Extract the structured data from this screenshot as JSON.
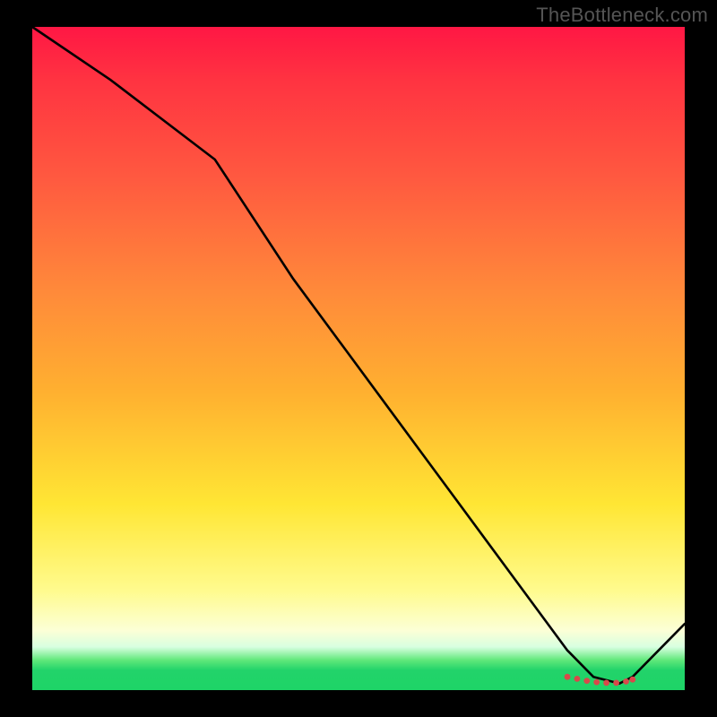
{
  "watermark": "TheBottleneck.com",
  "chart_data": {
    "type": "line",
    "title": "",
    "xlabel": "",
    "ylabel": "",
    "xlim": [
      0,
      100
    ],
    "ylim": [
      0,
      100
    ],
    "series": [
      {
        "name": "curve",
        "x": [
          0,
          12,
          28,
          40,
          55,
          70,
          82,
          86,
          90,
          92,
          100
        ],
        "y": [
          100,
          92,
          80,
          62,
          42,
          22,
          6,
          2,
          1,
          2,
          10
        ]
      }
    ],
    "markers": {
      "name": "dots",
      "color": "#d8494a",
      "x": [
        82,
        83.5,
        85,
        86.5,
        88,
        89.5,
        91,
        92
      ],
      "y": [
        2.0,
        1.7,
        1.4,
        1.2,
        1.1,
        1.1,
        1.3,
        1.6
      ]
    },
    "gradient_stops": [
      {
        "pos": 0,
        "color": "#ff1744"
      },
      {
        "pos": 0.4,
        "color": "#ff8a3a"
      },
      {
        "pos": 0.72,
        "color": "#ffe634"
      },
      {
        "pos": 0.91,
        "color": "#fcffd6"
      },
      {
        "pos": 0.97,
        "color": "#22d36a"
      },
      {
        "pos": 1.0,
        "color": "#1ed467"
      }
    ]
  }
}
